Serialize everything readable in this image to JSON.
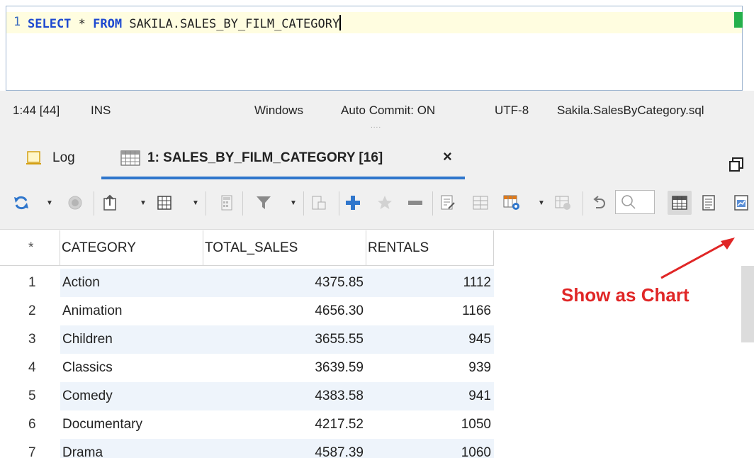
{
  "editor": {
    "line_number": "1",
    "sql": {
      "kw_select": "SELECT",
      "star": "*",
      "kw_from": "FROM",
      "table": "SAKILA.SALES_BY_FILM_CATEGORY"
    }
  },
  "status": {
    "position": "1:44 [44]",
    "mode": "INS",
    "line_endings": "Windows",
    "auto_commit": "Auto Commit: ON",
    "encoding": "UTF-8",
    "file": "Sakila.SalesByCategory.sql",
    "grip": "...."
  },
  "tabs": {
    "log_label": "Log",
    "result_label": "1: SALES_BY_FILM_CATEGORY [16]",
    "close_glyph": "×"
  },
  "grid": {
    "corner": "*",
    "columns": [
      "CATEGORY",
      "TOTAL_SALES",
      "RENTALS"
    ],
    "rows": [
      {
        "num": "1",
        "category": "Action",
        "total_sales": "4375.85",
        "rentals": "1112"
      },
      {
        "num": "2",
        "category": "Animation",
        "total_sales": "4656.30",
        "rentals": "1166"
      },
      {
        "num": "3",
        "category": "Children",
        "total_sales": "3655.55",
        "rentals": "945"
      },
      {
        "num": "4",
        "category": "Classics",
        "total_sales": "3639.59",
        "rentals": "939"
      },
      {
        "num": "5",
        "category": "Comedy",
        "total_sales": "4383.58",
        "rentals": "941"
      },
      {
        "num": "6",
        "category": "Documentary",
        "total_sales": "4217.52",
        "rentals": "1050"
      },
      {
        "num": "7",
        "category": "Drama",
        "total_sales": "4587.39",
        "rentals": "1060"
      }
    ]
  },
  "annotation": {
    "text": "Show as Chart",
    "color": "#e02626"
  },
  "colors": {
    "accent": "#2f76cc",
    "keyword": "#1c48d0"
  }
}
